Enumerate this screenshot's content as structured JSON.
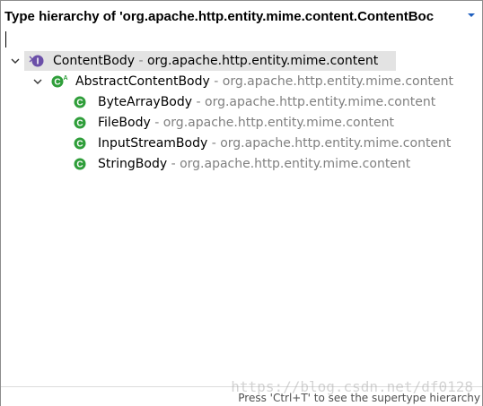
{
  "popup": {
    "title": "Type hierarchy of 'org.apache.http.entity.mime.content.ContentBoc",
    "menu_icon": "chevron-down-icon",
    "filter_value": ""
  },
  "tree": {
    "nodes": [
      {
        "name": "ContentBody",
        "separator": " - ",
        "package": "org.apache.http.entity.mime.content",
        "kind": "interface",
        "icon": "interface-icon",
        "icon_letter": "I",
        "expanded": true,
        "selected": true,
        "depth": 0
      },
      {
        "name": "AbstractContentBody",
        "separator": " - ",
        "package": "org.apache.http.entity.mime.content",
        "kind": "abstract-class",
        "icon": "abstract-class-icon",
        "icon_letter": "C",
        "icon_badge": "A",
        "expanded": true,
        "selected": false,
        "depth": 1
      },
      {
        "name": "ByteArrayBody",
        "separator": " - ",
        "package": "org.apache.http.entity.mime.content",
        "kind": "class",
        "icon": "class-icon",
        "icon_letter": "C",
        "depth": 2
      },
      {
        "name": "FileBody",
        "separator": " - ",
        "package": "org.apache.http.entity.mime.content",
        "kind": "class",
        "icon": "class-icon",
        "icon_letter": "C",
        "depth": 2
      },
      {
        "name": "InputStreamBody",
        "separator": " - ",
        "package": "org.apache.http.entity.mime.content",
        "kind": "class",
        "icon": "class-icon",
        "icon_letter": "C",
        "depth": 2
      },
      {
        "name": "StringBody",
        "separator": " - ",
        "package": "org.apache.http.entity.mime.content",
        "kind": "class",
        "icon": "class-icon",
        "icon_letter": "C",
        "depth": 2
      }
    ]
  },
  "status": {
    "hint": "Press 'Ctrl+T' to see the supertype hierarchy"
  },
  "watermark": {
    "text": "https://blog.csdn.net/df0128"
  },
  "colors": {
    "interface_icon": "#6b4fa8",
    "class_icon": "#2f9e3a",
    "selection": "#e3e3e3",
    "package_text": "#808080"
  }
}
